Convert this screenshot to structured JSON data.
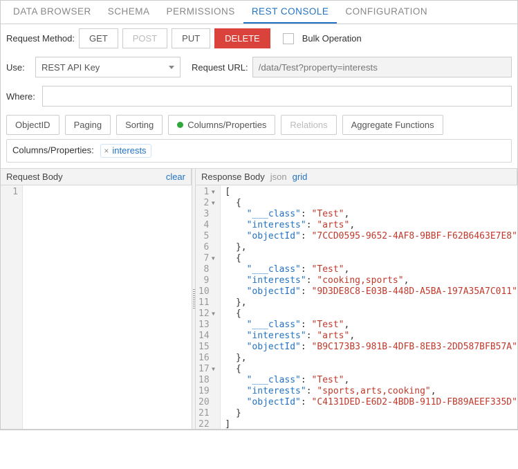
{
  "tabs": [
    "DATA BROWSER",
    "SCHEMA",
    "PERMISSIONS",
    "REST CONSOLE",
    "CONFIGURATION"
  ],
  "active_tab": "REST CONSOLE",
  "request_method_label": "Request Method:",
  "methods": {
    "get": "GET",
    "post": "POST",
    "put": "PUT",
    "delete": "DELETE"
  },
  "bulk_label": "Bulk Operation",
  "use_label": "Use:",
  "use_value": "REST API Key",
  "request_url_label": "Request URL:",
  "request_url_value": "/data/Test?property=interests",
  "where_label": "Where:",
  "where_value": "",
  "opt_buttons": {
    "objectid": "ObjectID",
    "paging": "Paging",
    "sorting": "Sorting",
    "columns": "Columns/Properties",
    "relations": "Relations",
    "aggregate": "Aggregate Functions"
  },
  "columns_label": "Columns/Properties:",
  "tag_value": "interests",
  "request_body_title": "Request Body",
  "clear_label": "clear",
  "response_body_title": "Response Body",
  "json_label": "json",
  "grid_label": "grid",
  "response_lines": 22,
  "chart_data": {
    "type": "table",
    "title": "Response Body (JSON array)",
    "columns": [
      "___class",
      "interests",
      "objectId"
    ],
    "rows": [
      [
        "Test",
        "arts",
        "7CCD0595-9652-4AF8-9BBF-F62B6463E7E8"
      ],
      [
        "Test",
        "cooking,sports",
        "9D3DE8C8-E03B-448D-A5BA-197A35A7C011"
      ],
      [
        "Test",
        "arts",
        "B9C173B3-981B-4DFB-8EB3-2DD587BFB57A"
      ],
      [
        "Test",
        "sports,arts,cooking",
        "C4131DED-E6D2-4BDB-911D-FB89AEEF335D"
      ]
    ]
  }
}
